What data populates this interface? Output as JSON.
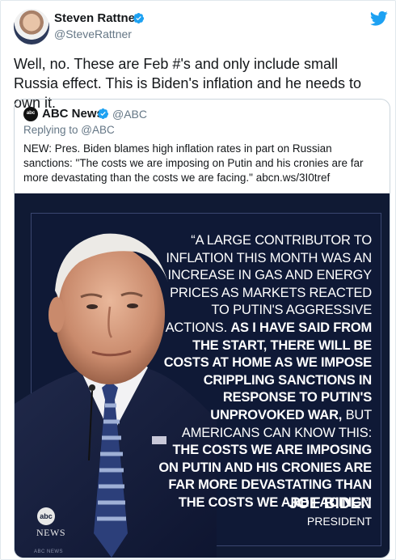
{
  "tweet": {
    "author_name": "Steven Rattner",
    "author_handle": "@SteveRattner",
    "text": "Well, no. These are Feb #'s and only include small Russia effect. This is Biden's inflation and he needs to own it."
  },
  "quoted_tweet": {
    "author_name": "ABC News",
    "author_handle": "@ABC",
    "avatar_text": "abc",
    "replying_to": "Replying to @ABC",
    "text": "NEW: Pres. Biden blames high inflation rates in part on Russian sanctions: \"The costs we are imposing on Putin and his cronies are far more devastating than the costs we are facing.\" abcn.ws/3I0tref",
    "media": {
      "quote_lines": [
        {
          "text": "“A LARGE CONTRIBUTOR TO",
          "weight": "light"
        },
        {
          "text": "INFLATION THIS MONTH WAS AN",
          "weight": "light"
        },
        {
          "text": "INCREASE IN GAS AND ENERGY",
          "weight": "light"
        },
        {
          "text": "PRICES AS MARKETS REACTED",
          "weight": "light"
        },
        {
          "text": "TO PUTIN'S AGGRESSIVE",
          "weight": "light"
        },
        {
          "text": "ACTIONS. AS I HAVE SAID FROM",
          "weight": "mixed",
          "light": "ACTIONS. ",
          "bold": "AS I HAVE SAID FROM"
        },
        {
          "text": "THE START, THERE WILL BE",
          "weight": "bold"
        },
        {
          "text": "COSTS AT HOME AS WE IMPOSE",
          "weight": "bold"
        },
        {
          "text": "CRIPPLING SANCTIONS IN",
          "weight": "bold"
        },
        {
          "text": "RESPONSE TO PUTIN'S",
          "weight": "bold"
        },
        {
          "text": "UNPROVOKED WAR, BUT",
          "weight": "mixed",
          "bold": "UNPROVOKED WAR,",
          "light": " BUT"
        },
        {
          "text": "AMERICANS CAN KNOW THIS:",
          "weight": "light"
        },
        {
          "text": "THE COSTS WE ARE IMPOSING",
          "weight": "bold"
        },
        {
          "text": "ON PUTIN AND HIS CRONIES ARE",
          "weight": "bold"
        },
        {
          "text": "FAR MORE DEVASTATING THAN",
          "weight": "bold"
        },
        {
          "text": "THE COSTS WE ARE FACING.”",
          "weight": "bold"
        }
      ],
      "attribution_name": "JOE BIDEN",
      "attribution_title": "PRESIDENT",
      "logo_text": "abc",
      "news_mark": "NEWS",
      "footer_mark": "ABC NEWS"
    }
  },
  "colors": {
    "verified": "#1da1f2",
    "twitter_blue": "#1da1f2",
    "media_bg": "#101a34"
  },
  "icons": [
    "verified-badge-icon",
    "twitter-bird-icon"
  ]
}
